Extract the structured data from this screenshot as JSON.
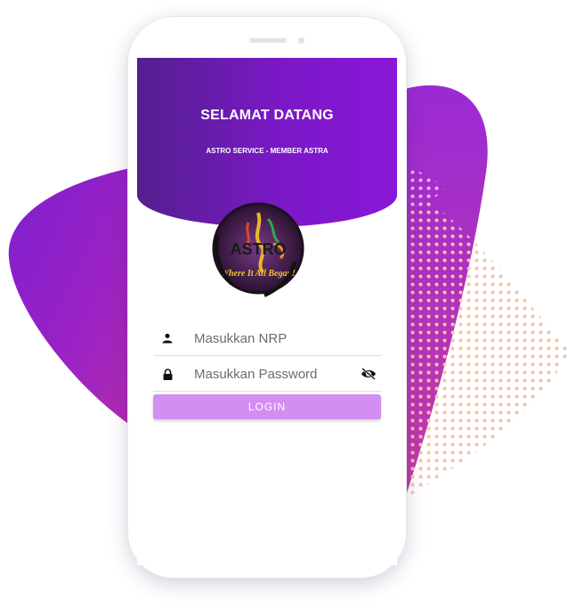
{
  "header": {
    "title": "SELAMAT DATANG",
    "subtitle": "ASTRO SERVICE - MEMBER ASTRA"
  },
  "logo": {
    "text": "ASTRO",
    "tagline": "Where It All Began!"
  },
  "form": {
    "nrp_placeholder": "Masukkan NRP",
    "password_placeholder": "Masukkan Password",
    "login_label": "LOGIN"
  },
  "icons": {
    "user": "person-icon",
    "lock": "lock-icon",
    "toggle": "eye-off-icon"
  },
  "colors": {
    "header_start": "#53208f",
    "header_end": "#8a17d8",
    "button": "#d38ef2",
    "accent_dots": "#f7c4a6"
  }
}
